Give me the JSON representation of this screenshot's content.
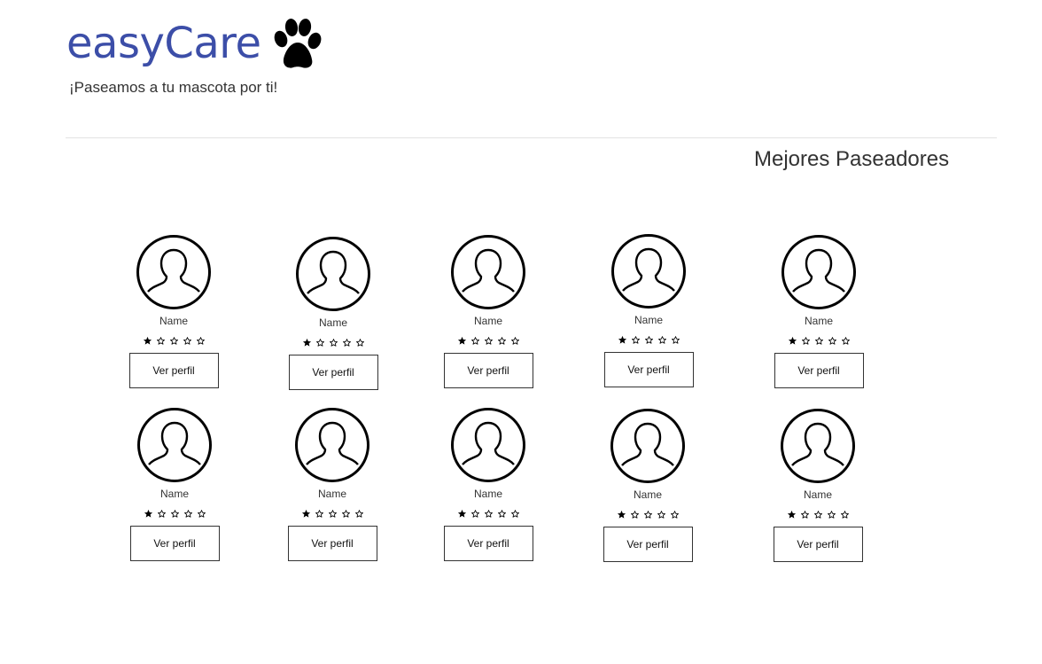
{
  "header": {
    "brand": "easyCare",
    "tagline": "¡Paseamos a tu mascota por ti!",
    "logo_icon": "paw-icon",
    "brand_color": "#3c4ea8"
  },
  "section": {
    "title": "Mejores Paseadores"
  },
  "walkers": [
    {
      "name": "Name",
      "rating": 1,
      "button": "Ver perfil"
    },
    {
      "name": "Name",
      "rating": 1,
      "button": "Ver perfil"
    },
    {
      "name": "Name",
      "rating": 1,
      "button": "Ver perfil"
    },
    {
      "name": "Name",
      "rating": 1,
      "button": "Ver perfil"
    },
    {
      "name": "Name",
      "rating": 1,
      "button": "Ver perfil"
    },
    {
      "name": "Name",
      "rating": 1,
      "button": "Ver perfil"
    },
    {
      "name": "Name",
      "rating": 1,
      "button": "Ver perfil"
    },
    {
      "name": "Name",
      "rating": 1,
      "button": "Ver perfil"
    },
    {
      "name": "Name",
      "rating": 1,
      "button": "Ver perfil"
    },
    {
      "name": "Name",
      "rating": 1,
      "button": "Ver perfil"
    }
  ],
  "rating_max": 5
}
